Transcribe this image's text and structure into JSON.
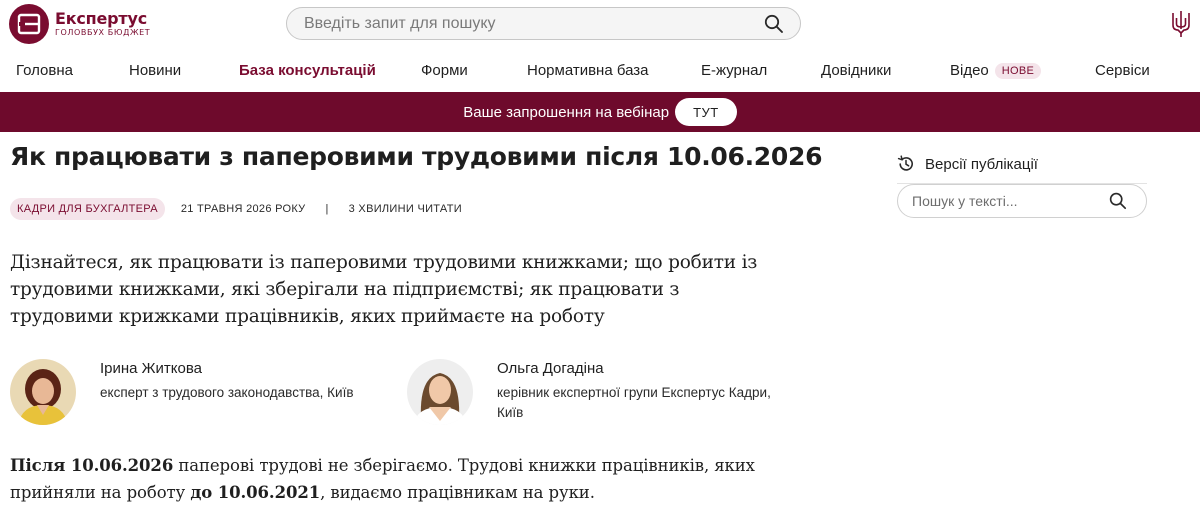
{
  "logo": {
    "name": "Експертус",
    "subtitle": "ГОЛОВБУХ БЮДЖЕТ"
  },
  "search": {
    "placeholder": "Введіть запит для пошуку"
  },
  "nav": {
    "items": [
      {
        "label": "Головна"
      },
      {
        "label": "Новини"
      },
      {
        "label": "База консультацій",
        "active": true
      },
      {
        "label": "Форми"
      },
      {
        "label": "Нормативна база"
      },
      {
        "label": "Е-журнал"
      },
      {
        "label": "Довідники"
      },
      {
        "label": "Відео",
        "badge": "НОВЕ"
      },
      {
        "label": "Сервіси"
      }
    ]
  },
  "banner": {
    "text": "Ваше запрошення на вебінар",
    "button": "ТУТ"
  },
  "article": {
    "title": "Як працювати з паперовими трудовими після 10.06.2026",
    "tag": "КАДРИ ДЛЯ БУХГАЛТЕРА",
    "date": "21 ТРАВНЯ 2026 РОКУ",
    "separator": "|",
    "read_time": "3 ХВИЛИНИ ЧИТАТИ",
    "lead": "Дізнайтеся, як працювати із паперовими трудовими книжками; що робити із трудовими книжками, які зберігали на підприємстві; як працювати з трудовими крижками працівників, яких приймаєте на роботу",
    "authors": [
      {
        "name": "Ірина Житкова",
        "role": "експерт з трудового законодавства, Київ"
      },
      {
        "name": "Ольга Догадіна",
        "role": "керівник експертної групи Експертус Кадри, Київ"
      }
    ],
    "body": {
      "p1_b1": "Після 10.06.2026",
      "p1_t1": " паперові трудові не зберігаємо. Трудові книжки працівників, яких прийняли на роботу ",
      "p1_b2": "до 10.06.2021",
      "p1_t2": ", видаємо працівникам на руки."
    }
  },
  "sidebar": {
    "versions_label": "Версії публікації",
    "search_placeholder": "Пошук у тексті..."
  },
  "colors": {
    "brand": "#6e0a2c",
    "tag_bg": "#f4e4ea"
  }
}
